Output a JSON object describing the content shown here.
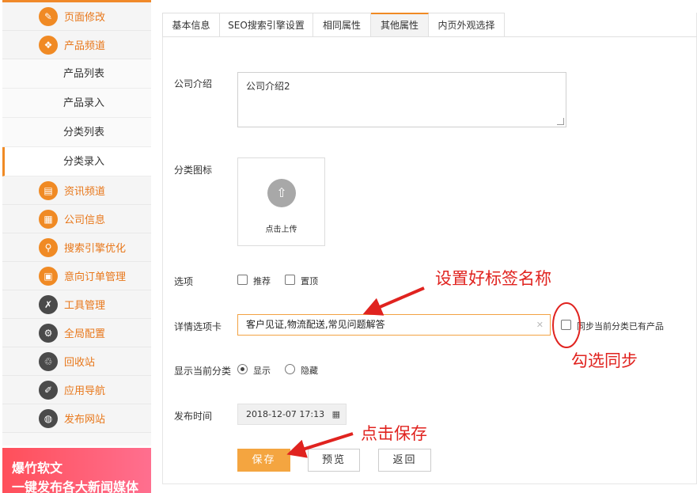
{
  "sidebar": {
    "items": [
      {
        "label": "页面修改",
        "icon": "pencil-icon"
      },
      {
        "label": "产品频道",
        "icon": "cube-icon"
      },
      {
        "label": "资讯频道",
        "icon": "newspaper-icon"
      },
      {
        "label": "公司信息",
        "icon": "document-icon"
      },
      {
        "label": "搜索引擎优化",
        "icon": "search-icon"
      },
      {
        "label": "意向订单管理",
        "icon": "order-icon"
      },
      {
        "label": "工具管理",
        "icon": "wrench-icon"
      },
      {
        "label": "全局配置",
        "icon": "gear-icon"
      },
      {
        "label": "回收站",
        "icon": "trash-icon"
      },
      {
        "label": "应用导航",
        "icon": "brush-icon"
      },
      {
        "label": "发布网站",
        "icon": "globe-icon"
      }
    ],
    "sub_items": [
      "产品列表",
      "产品录入",
      "分类列表",
      "分类录入"
    ],
    "active_sub": "分类录入"
  },
  "banner": {
    "line1": "爆竹软文",
    "line2": "一键发布各大新闻媒体"
  },
  "tabs": [
    "基本信息",
    "SEO搜索引擎设置",
    "相同属性",
    "其他属性",
    "内页外观选择"
  ],
  "active_tab": "其他属性",
  "form": {
    "intro_label": "公司介绍",
    "intro_value": "公司介绍2",
    "icon_label": "分类图标",
    "upload_text": "点击上传",
    "options_label": "选项",
    "opt_recommend": "推荐",
    "opt_top": "置顶",
    "tabs_label": "详情选项卡",
    "tabs_value": "客户见证,物流配送,常见问题解答",
    "sync_label": "同步当前分类已有产品",
    "show_label": "显示当前分类",
    "show_yes": "显示",
    "show_no": "隐藏",
    "date_label": "发布时间",
    "date_value": "2018-12-07 17:13",
    "save": "保存",
    "preview": "预览",
    "back": "返回"
  },
  "annotations": {
    "set_tab_name": "设置好标签名称",
    "check_sync": "勾选同步",
    "click_save": "点击保存"
  },
  "colors": {
    "accent": "#f08a24",
    "annotation": "#e0231f"
  }
}
